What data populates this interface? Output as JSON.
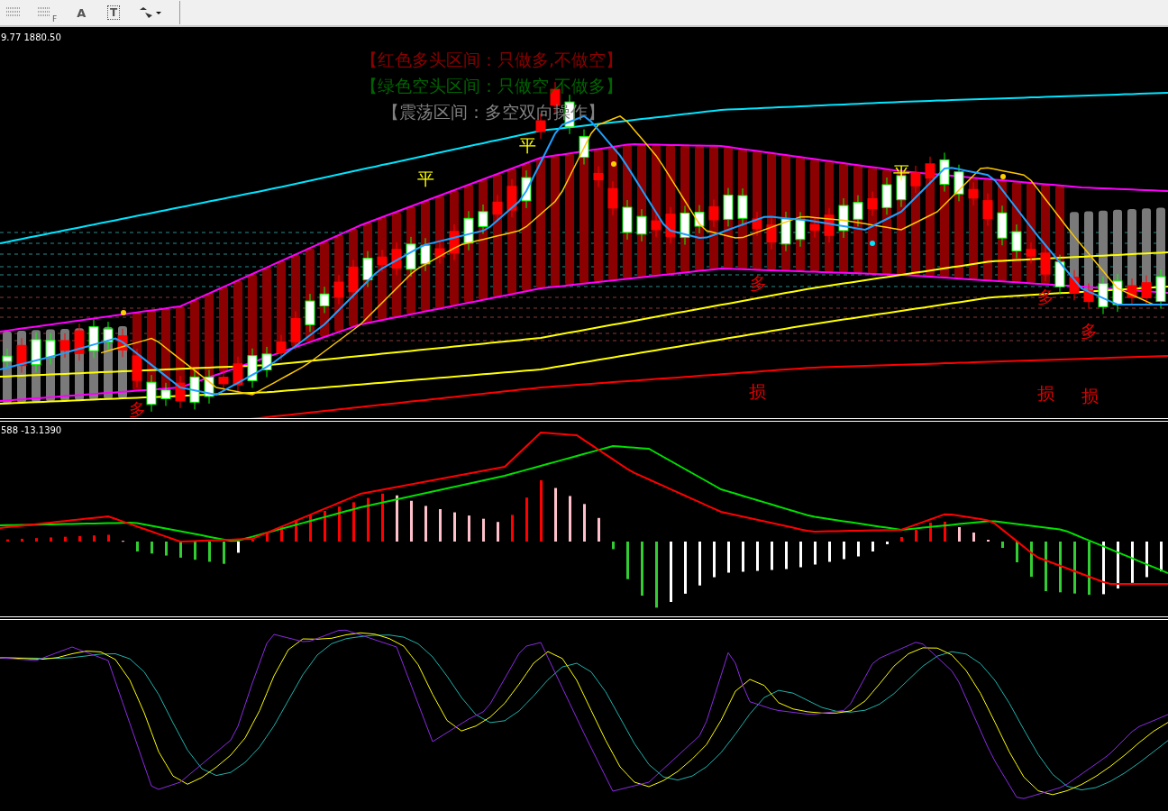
{
  "toolbar": {
    "fibo_label": "F",
    "text_label": "A",
    "text_box_label": "T"
  },
  "main_chart": {
    "price_readout": "9.77 1880.50",
    "legend": [
      {
        "text": "【红色多头区间：只做多,不做空】",
        "color": "#8b0000"
      },
      {
        "text": "【绿色空头区间：只做空,不做多】",
        "color": "#006400"
      },
      {
        "text": "【震荡区间：多空双向操作】",
        "color": "#808080"
      }
    ],
    "signals": [
      {
        "kind": "flat",
        "text": "平"
      },
      {
        "kind": "flat",
        "text": "平"
      },
      {
        "kind": "flat",
        "text": "平"
      },
      {
        "kind": "long",
        "text": "多"
      },
      {
        "kind": "long",
        "text": "多"
      },
      {
        "kind": "long",
        "text": "多"
      },
      {
        "kind": "stop",
        "text": "损"
      },
      {
        "kind": "stop",
        "text": "损"
      },
      {
        "kind": "stop",
        "text": "损"
      },
      {
        "kind": "long",
        "text": "多"
      }
    ]
  },
  "macd_panel": {
    "readout": "588 -13.1390"
  }
}
